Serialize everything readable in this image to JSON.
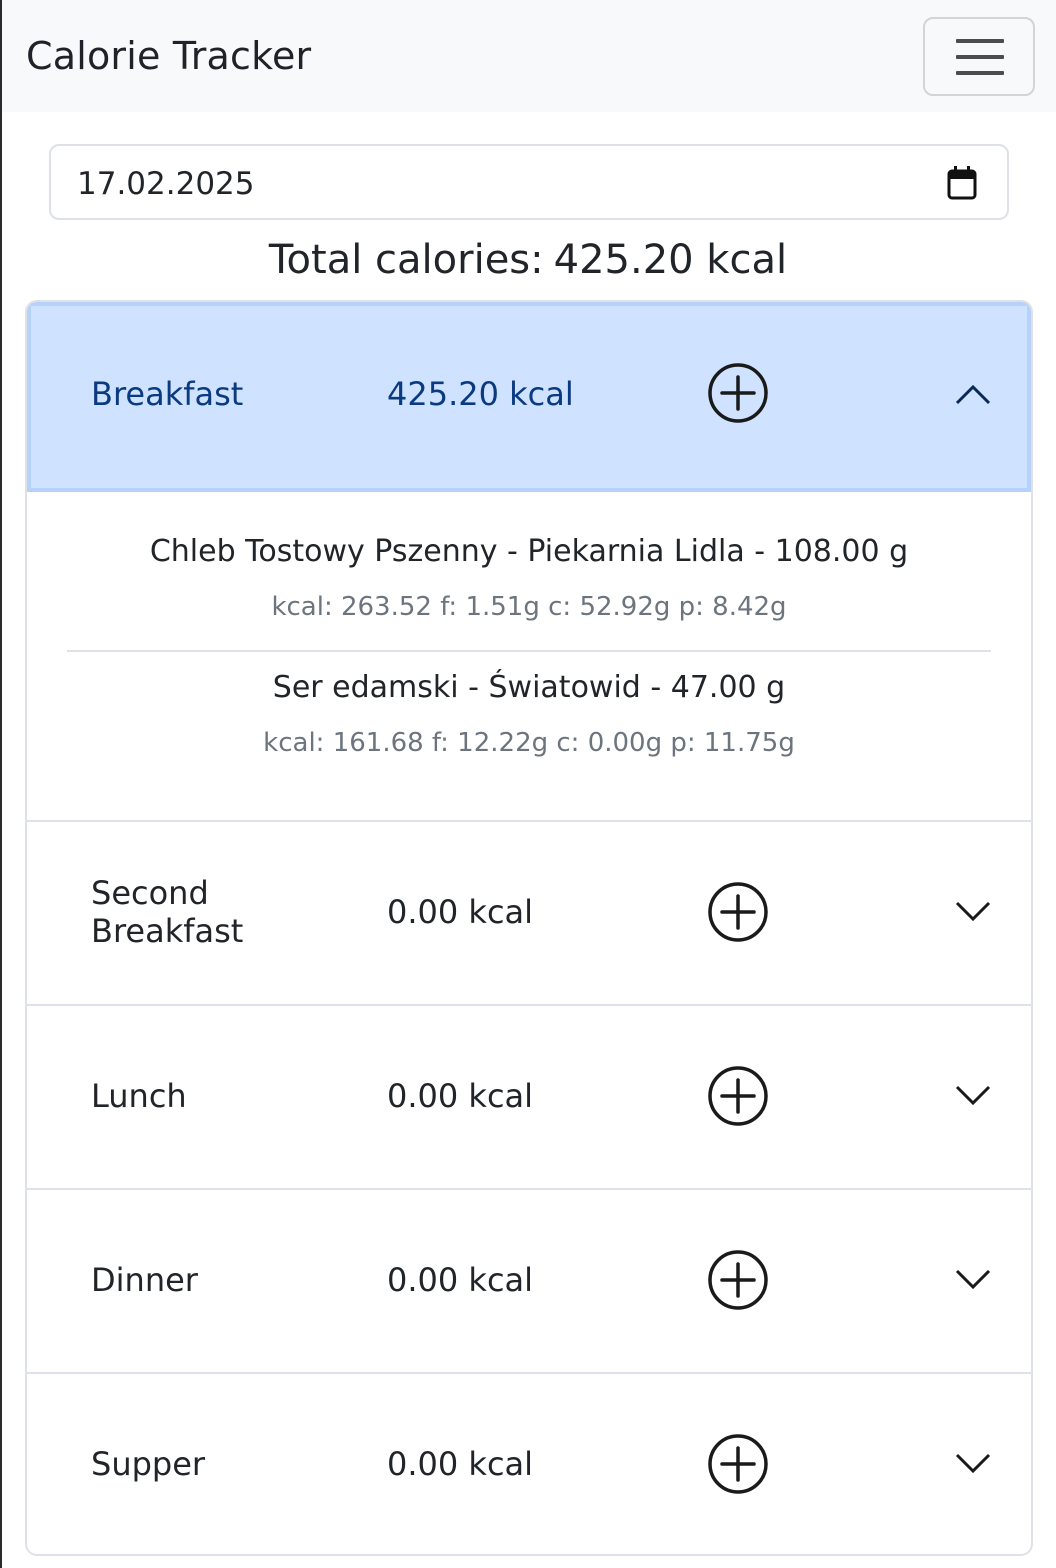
{
  "app": {
    "title": "Calorie Tracker"
  },
  "date_input": {
    "value": "17.02.2025"
  },
  "summary": {
    "label": "Total calories:",
    "value": "425.20 kcal"
  },
  "meals": [
    {
      "name": "Breakfast",
      "kcal": "425.20 kcal",
      "expanded": true,
      "items": [
        {
          "title": "Chleb Tostowy Pszenny - Piekarnia Lidla - 108.00 g",
          "macros": "kcal: 263.52 f: 1.51g c: 52.92g p: 8.42g"
        },
        {
          "title": "Ser edamski - Światowid - 47.00 g",
          "macros": "kcal: 161.68 f: 12.22g c: 0.00g p: 11.75g"
        }
      ]
    },
    {
      "name": "Second\nBreakfast",
      "kcal": "0.00 kcal",
      "expanded": false
    },
    {
      "name": "Lunch",
      "kcal": "0.00 kcal",
      "expanded": false
    },
    {
      "name": "Dinner",
      "kcal": "0.00 kcal",
      "expanded": false
    },
    {
      "name": "Supper",
      "kcal": "0.00 kcal",
      "expanded": false
    }
  ],
  "icons": {
    "menu": "hamburger-icon",
    "calendar": "calendar-icon",
    "add": "plus-circle-icon",
    "expand": "chevron-down-icon",
    "collapse": "chevron-up-icon"
  },
  "colors": {
    "active_header_bg": "#cfe2ff",
    "active_header_text": "#0a3a80",
    "navbar_bg": "#f8f9fa",
    "muted_text": "#6c757d"
  }
}
